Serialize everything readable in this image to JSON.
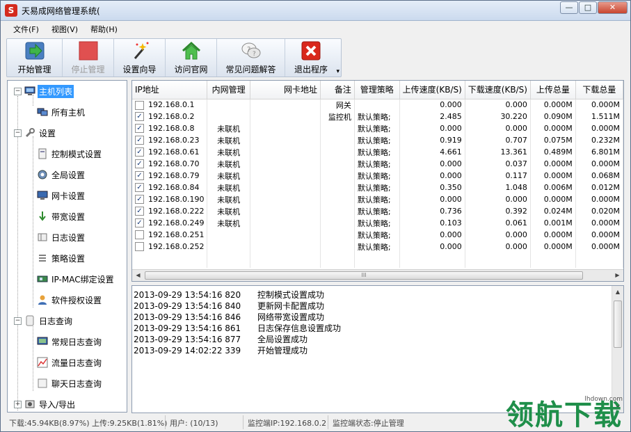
{
  "window": {
    "title": "天易成网络管理系统(",
    "app_icon": "S",
    "controls": {
      "minimize": "—",
      "maximize": "□",
      "close": "✕"
    }
  },
  "menu": [
    "文件(F)",
    "视图(V)",
    "帮助(H)"
  ],
  "toolbar": [
    {
      "label": "开始管理",
      "icon": "start-arrow-icon",
      "disabled": false
    },
    {
      "label": "停止管理",
      "icon": "stop-square-icon",
      "disabled": true
    },
    {
      "label": "设置向导",
      "icon": "magic-wand-icon",
      "disabled": false
    },
    {
      "label": "访问官网",
      "icon": "home-icon",
      "disabled": false
    },
    {
      "label": "常见问题解答",
      "icon": "faq-bubbles-icon",
      "disabled": false
    },
    {
      "label": "退出程序",
      "icon": "exit-x-icon",
      "disabled": false
    }
  ],
  "tree": [
    {
      "label": "主机列表",
      "level": 0,
      "expander": "−",
      "icon": "computer-icon",
      "selected": true
    },
    {
      "label": "所有主机",
      "level": 1,
      "icon": "hosts-icon"
    },
    {
      "label": "设置",
      "level": 0,
      "expander": "−",
      "icon": "wrench-icon"
    },
    {
      "label": "控制模式设置",
      "level": 1,
      "icon": "control-mode-icon"
    },
    {
      "label": "全局设置",
      "level": 1,
      "icon": "gear-icon"
    },
    {
      "label": "网卡设置",
      "level": 1,
      "icon": "network-card-icon"
    },
    {
      "label": "带宽设置",
      "level": 1,
      "icon": "bandwidth-arrow-icon"
    },
    {
      "label": "日志设置",
      "level": 1,
      "icon": "log-settings-icon"
    },
    {
      "label": "策略设置",
      "level": 1,
      "icon": "policy-list-icon"
    },
    {
      "label": "IP-MAC绑定设置",
      "level": 1,
      "icon": "ip-mac-bind-icon"
    },
    {
      "label": "软件授权设置",
      "level": 1,
      "icon": "license-user-icon"
    },
    {
      "label": "日志查询",
      "level": 0,
      "expander": "−",
      "icon": "log-query-icon"
    },
    {
      "label": "常规日志查询",
      "level": 1,
      "icon": "normal-log-icon"
    },
    {
      "label": "流量日志查询",
      "level": 1,
      "icon": "traffic-chart-icon"
    },
    {
      "label": "聊天日志查询",
      "level": 1,
      "icon": "chat-log-icon"
    },
    {
      "label": "导入/导出",
      "level": 0,
      "expander": "+",
      "icon": "import-export-icon"
    }
  ],
  "table": {
    "columns": [
      "IP地址",
      "内网管理",
      "网卡地址",
      "备注",
      "管理策略",
      "上传速度(KB/S)",
      "下载速度(KB/S)",
      "上传总量",
      "下载总量"
    ],
    "rows": [
      {
        "checked": false,
        "cells": [
          "192.168.0.1",
          "",
          "",
          "网关",
          "",
          "0.000",
          "0.000",
          "0.000M",
          "0.000M"
        ]
      },
      {
        "checked": true,
        "cells": [
          "192.168.0.2",
          "",
          "",
          "监控机",
          "默认策略;",
          "2.485",
          "30.220",
          "0.090M",
          "1.511M"
        ]
      },
      {
        "checked": true,
        "cells": [
          "192.168.0.8",
          "未联机",
          "",
          "",
          "默认策略;",
          "0.000",
          "0.000",
          "0.000M",
          "0.000M"
        ]
      },
      {
        "checked": true,
        "cells": [
          "192.168.0.23",
          "未联机",
          "",
          "",
          "默认策略;",
          "0.919",
          "0.707",
          "0.075M",
          "0.232M"
        ]
      },
      {
        "checked": true,
        "cells": [
          "192.168.0.61",
          "未联机",
          "",
          "",
          "默认策略;",
          "4.661",
          "13.361",
          "0.489M",
          "6.801M"
        ]
      },
      {
        "checked": true,
        "cells": [
          "192.168.0.70",
          "未联机",
          "",
          "",
          "默认策略;",
          "0.000",
          "0.037",
          "0.000M",
          "0.000M"
        ]
      },
      {
        "checked": true,
        "cells": [
          "192.168.0.79",
          "未联机",
          "",
          "",
          "默认策略;",
          "0.000",
          "0.117",
          "0.000M",
          "0.068M"
        ]
      },
      {
        "checked": true,
        "cells": [
          "192.168.0.84",
          "未联机",
          "",
          "",
          "默认策略;",
          "0.350",
          "1.048",
          "0.006M",
          "0.012M"
        ]
      },
      {
        "checked": true,
        "cells": [
          "192.168.0.190",
          "未联机",
          "",
          "",
          "默认策略;",
          "0.000",
          "0.000",
          "0.000M",
          "0.000M"
        ]
      },
      {
        "checked": true,
        "cells": [
          "192.168.0.222",
          "未联机",
          "",
          "",
          "默认策略;",
          "0.736",
          "0.392",
          "0.024M",
          "0.020M"
        ]
      },
      {
        "checked": true,
        "cells": [
          "192.168.0.249",
          "未联机",
          "",
          "",
          "默认策略;",
          "0.103",
          "0.061",
          "0.001M",
          "0.000M"
        ]
      },
      {
        "checked": false,
        "cells": [
          "192.168.0.251",
          "",
          "",
          "",
          "默认策略;",
          "0.000",
          "0.000",
          "0.000M",
          "0.000M"
        ]
      },
      {
        "checked": false,
        "cells": [
          "192.168.0.252",
          "",
          "",
          "",
          "默认策略;",
          "0.000",
          "0.000",
          "0.000M",
          "0.000M"
        ]
      }
    ]
  },
  "scroll": {
    "left": "◀",
    "right": "▶",
    "up": "▲",
    "down": "▼",
    "grip": "III"
  },
  "log": [
    {
      "time": "2013-09-29 13:54:16 820",
      "msg": "控制模式设置成功"
    },
    {
      "time": "2013-09-29 13:54:16 840",
      "msg": "更新网卡配置成功"
    },
    {
      "time": "2013-09-29 13:54:16 846",
      "msg": "网络带宽设置成功"
    },
    {
      "time": "2013-09-29 13:54:16 861",
      "msg": "日志保存信息设置成功"
    },
    {
      "time": "2013-09-29 13:54:16 877",
      "msg": "全局设置成功"
    },
    {
      "time": "2013-09-29 14:02:22 339",
      "msg": "开始管理成功"
    }
  ],
  "status": {
    "traffic": "下载:45.94KB(8.97%) 上传:9.25KB(1.81%)",
    "users": "用户: (10/13)",
    "monitor_ip": "监控端IP:192.168.0.2",
    "monitor_state": "监控端状态:停止管理"
  },
  "watermark": {
    "text": "领航下载",
    "site": "lhdown.com"
  },
  "colors": {
    "selected": "#3399ff",
    "stop_icon": "#e05050",
    "exit_icon": "#d9281c",
    "start_icon": "#2f9a3a",
    "watermark": "#1f8f4a"
  }
}
